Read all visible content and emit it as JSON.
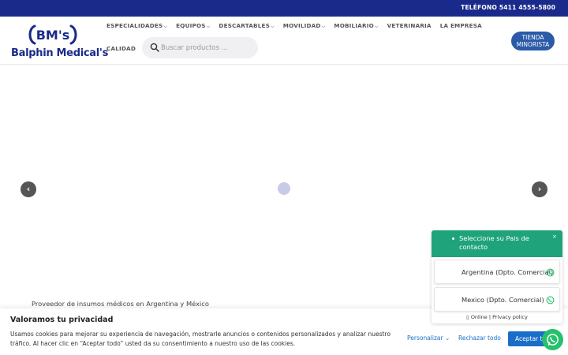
{
  "topbar": {
    "phone": "TELÉFONO 5411 4555-5800"
  },
  "header": {
    "logo_mark": "BM's",
    "logo_text": "Balphin Medical's",
    "nav": [
      {
        "label": "ESPECIALIDADES",
        "has_dropdown": true
      },
      {
        "label": "EQUIPOS",
        "has_dropdown": true
      },
      {
        "label": "DESCARTABLES",
        "has_dropdown": true
      },
      {
        "label": "MOVILIDAD",
        "has_dropdown": true
      },
      {
        "label": "MOBILIARIO",
        "has_dropdown": true
      },
      {
        "label": "VETERINARIA",
        "has_dropdown": false
      },
      {
        "label": "LA EMPRESA",
        "has_dropdown": false
      }
    ],
    "nav_second_row": "CALIDAD",
    "search_placeholder": "Buscar productos ...",
    "tienda_line1": "TIENDA",
    "tienda_line2": "MINORISTA",
    "brand_color": "#1a2a8a",
    "accent_color": "#2a5aa8"
  },
  "slider": {
    "prev_icon": "‹",
    "next_icon": "›"
  },
  "tagline": "Proveedor de insumos médicos en Argentina y México",
  "cookie": {
    "title": "Valoramos tu privacidad",
    "text": "Usamos cookies para mejorar su experiencia de navegación, mostrarle anuncios o contenidos personalizados y analizar nuestro tráfico. Al hacer clic en “Aceptar todo” usted da su consentimiento a nuestro uso de las cookies.",
    "customize": "Personalizar",
    "reject": "Rechazar todo",
    "accept": "Aceptar todo",
    "accent_color": "#1a6ec8"
  },
  "whatsapp": {
    "header": "Seleccione su Pais de contacto",
    "close": "×",
    "options": [
      {
        "label": "Argentina (Dpto. Comercial)"
      },
      {
        "label": "Mexico (Dpto. Comercial)"
      }
    ],
    "footer": "Online | Privacy policy",
    "color": "#1fa37a"
  }
}
